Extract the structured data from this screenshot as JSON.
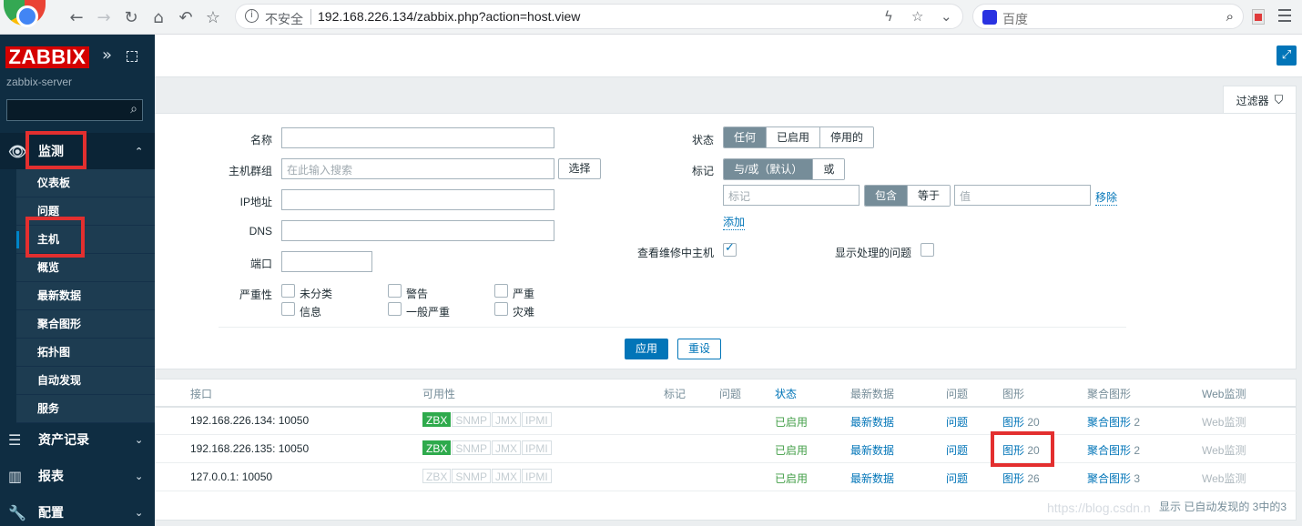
{
  "browser": {
    "security_label": "不安全",
    "url": "192.168.226.134/zabbix.php?action=host.view",
    "search_placeholder": "百度"
  },
  "sidebar": {
    "logo": "ZABBIX",
    "server": "zabbix-server",
    "sections": {
      "monitoring": "监测",
      "inventory": "资产记录",
      "reports": "报表",
      "config": "配置"
    },
    "submenu": [
      "仪表板",
      "问题",
      "主机",
      "概览",
      "最新数据",
      "聚合图形",
      "拓扑图",
      "自动发现",
      "服务"
    ],
    "active_item": "主机"
  },
  "filter": {
    "tab_label": "过滤器",
    "name_label": "名称",
    "hostgroup_label": "主机群组",
    "hostgroup_placeholder": "在此输入搜索",
    "select_btn": "选择",
    "ip_label": "IP地址",
    "dns_label": "DNS",
    "port_label": "端口",
    "severity_label": "严重性",
    "severities": [
      "未分类",
      "警告",
      "严重",
      "信息",
      "一般严重",
      "灾难"
    ],
    "status_label": "状态",
    "status_options": [
      "任何",
      "已启用",
      "停用的"
    ],
    "status_selected": "任何",
    "tags_label": "标记",
    "tag_eval_options": [
      "与/或（默认）",
      "或"
    ],
    "tag_placeholder": "标记",
    "tag_op_options": [
      "包含",
      "等于"
    ],
    "value_placeholder": "值",
    "remove_link": "移除",
    "add_link": "添加",
    "maintenance_label": "查看维修中主机",
    "maintenance_checked": true,
    "suppressed_label": "显示处理的问题",
    "suppressed_checked": false,
    "apply_btn": "应用",
    "reset_btn": "重设"
  },
  "table": {
    "columns": [
      "接口",
      "可用性",
      "标记",
      "问题",
      "状态",
      "最新数据",
      "问题",
      "图形",
      "聚合图形",
      "Web监测"
    ],
    "rows": [
      {
        "interface": "192.168.226.134: 10050",
        "zbx_active": true,
        "status": "已启用",
        "latest": "最新数据",
        "problems": "问题",
        "graphs": "图形",
        "graphs_count": "20",
        "screens": "聚合图形",
        "screens_count": "2",
        "web": "Web监测"
      },
      {
        "interface": "192.168.226.135: 10050",
        "zbx_active": true,
        "status": "已启用",
        "latest": "最新数据",
        "problems": "问题",
        "graphs": "图形",
        "graphs_count": "20",
        "screens": "聚合图形",
        "screens_count": "2",
        "web": "Web监测"
      },
      {
        "interface": "127.0.0.1: 10050",
        "zbx_active": false,
        "status": "已启用",
        "latest": "最新数据",
        "problems": "问题",
        "graphs": "图形",
        "graphs_count": "26",
        "screens": "聚合图形",
        "screens_count": "3",
        "web": "Web监测"
      }
    ],
    "availability_labels": [
      "ZBX",
      "SNMP",
      "JMX",
      "IPMI"
    ],
    "footer": "显示 已自动发现的 3中的3"
  },
  "watermark": "https://blog.csdn.n",
  "colors": {
    "sidebar_bg": "#0f2d42",
    "brand_red": "#d40000",
    "link_blue": "#0275b8",
    "status_green": "#429e47",
    "zbx_green": "#2eaa4c",
    "highlight_red": "#e32f2f"
  }
}
